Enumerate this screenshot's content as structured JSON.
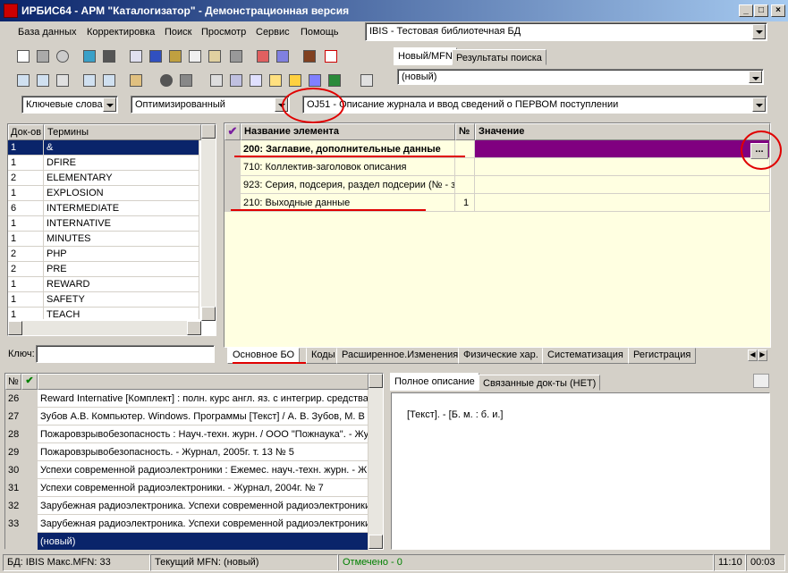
{
  "window": {
    "title": "ИРБИС64 - АРМ \"Каталогизатор\" - Демонстрационная версия",
    "btn_min": "_",
    "btn_max": "□",
    "btn_close": "×"
  },
  "menu": [
    "База данных",
    "Корректировка",
    "Поиск",
    "Просмотр",
    "Сервис",
    "Помощь"
  ],
  "db_combo": "IBIS - Тестовая библиотечная БД",
  "right_tabs": [
    "Новый/MFN",
    "Результаты поиска"
  ],
  "record_combo": "(новый)",
  "search": {
    "mode": "Ключевые слова",
    "strategy": "Оптимизированный",
    "worksheet": "OJ51 - Описание журнала и ввод сведений о ПЕРВОМ поступлении"
  },
  "terms": {
    "headers": [
      "Док-ов",
      "Термины"
    ],
    "rows": [
      [
        "1",
        "&"
      ],
      [
        "1",
        "DFIRE"
      ],
      [
        "2",
        "ELEMENTARY"
      ],
      [
        "1",
        "EXPLOSION"
      ],
      [
        "6",
        "INTERMEDIATE"
      ],
      [
        "1",
        "INTERNATIVE"
      ],
      [
        "1",
        "MINUTES"
      ],
      [
        "2",
        "PHP"
      ],
      [
        "2",
        "PRE"
      ],
      [
        "1",
        "REWARD"
      ],
      [
        "1",
        "SAFETY"
      ],
      [
        "1",
        "TEACH"
      ]
    ],
    "key_label": "Ключ:"
  },
  "editor": {
    "headers": [
      "Название элемента",
      "№",
      "Значение"
    ],
    "rows": [
      {
        "name": "200: Заглавие, дополнительные данные",
        "num": "",
        "value": ""
      },
      {
        "name": "710: Коллектив-заголовок описания",
        "num": "",
        "value": ""
      },
      {
        "name": "923: Серия, подсерия, раздел подсерии (№ - за",
        "num": "",
        "value": ""
      },
      {
        "name": "210: Выходные данные",
        "num": "1",
        "value": ""
      }
    ],
    "ellipsis": "...",
    "tabs": [
      "Основное БО",
      "Коды",
      "Расширенное.Изменения",
      "Физические хар.",
      "Систематизация",
      "Регистрация"
    ]
  },
  "records": {
    "headers": [
      "№",
      "✔"
    ],
    "rows": [
      [
        "26",
        "Reward Internative [Комплект] : полн. курс англ. яз. с интегрир. средства"
      ],
      [
        "27",
        "Зубов А.В. Компьютер. Windows. Программы [Текст] / А. В. Зубов, М. В"
      ],
      [
        "28",
        "Пожаровзрывобезопасность : Науч.-техн. журн. / ООО \"Пожнаука\". - Жу"
      ],
      [
        "29",
        "Пожаровзрывобезопасность. - Журнал, 2005г. т. 13 № 5"
      ],
      [
        "30",
        "Успехи современной радиоэлектроники : Ежемес. науч.-техн. журн. - Ж"
      ],
      [
        "31",
        "Успехи современной радиоэлектроники. - Журнал, 2004г. № 7"
      ],
      [
        "32",
        "Зарубежная радиоэлектроника. Успехи современной радиоэлектроники"
      ],
      [
        "33",
        "Зарубежная радиоэлектроника. Успехи современной радиоэлектроники"
      ],
      [
        "",
        "(новый)"
      ]
    ]
  },
  "desc_tabs": [
    "Полное описание",
    "Связанные док-ты (НЕТ)"
  ],
  "description": "[Текст]. - [Б. м. : б. и.]",
  "status": {
    "db": "БД: IBIS Макс.MFN: 33",
    "mfn": "Текущий MFN: (новый)",
    "marked": "Отмечено - 0",
    "time1": "11:10",
    "time2": "00:03"
  },
  "colors": {
    "selection": "#0a246a",
    "value_highlight": "#800080",
    "editor_bg": "#ffffe1",
    "annotation": "#e00000",
    "marked_text": "#008000"
  }
}
